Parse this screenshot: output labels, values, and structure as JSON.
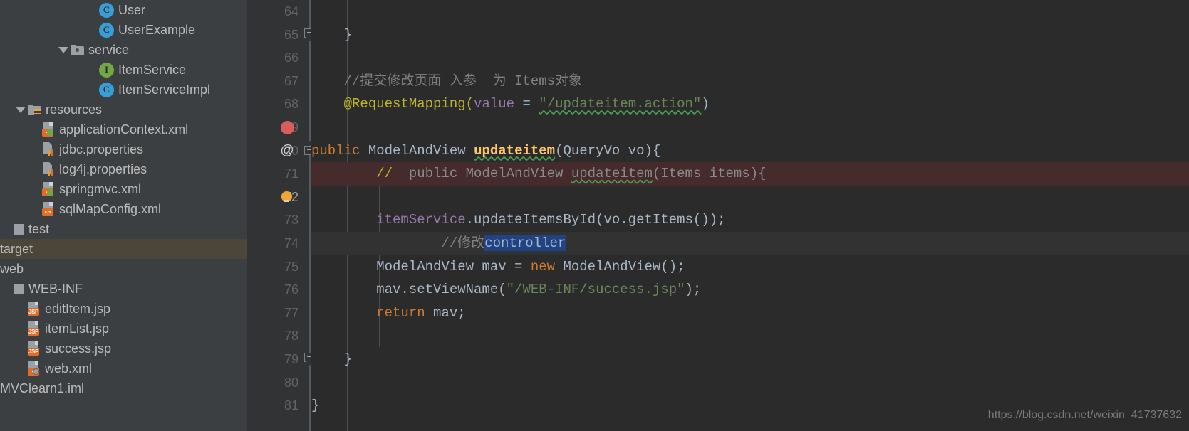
{
  "sidebar": {
    "items": [
      {
        "label": "User",
        "icon": "class-icon",
        "indent": 5,
        "arrow": false,
        "kind": "class",
        "selected": false
      },
      {
        "label": "UserExample",
        "icon": "class-icon",
        "indent": 5,
        "arrow": false,
        "kind": "class",
        "selected": false
      },
      {
        "label": "service",
        "icon": "folder-icon",
        "indent": 3,
        "arrow": true,
        "kind": "folder",
        "selected": false
      },
      {
        "label": "ItemService",
        "icon": "interface-icon",
        "indent": 5,
        "arrow": false,
        "kind": "interface",
        "selected": false
      },
      {
        "label": "ItemServiceImpl",
        "icon": "class-icon",
        "indent": 5,
        "arrow": false,
        "kind": "class",
        "selected": false
      },
      {
        "label": "resources",
        "icon": "resources-folder-icon",
        "indent": 0,
        "arrow": true,
        "kind": "resfolder",
        "selected": false
      },
      {
        "label": "applicationContext.xml",
        "icon": "spring-xml-icon",
        "indent": 1,
        "arrow": false,
        "kind": "springxml",
        "selected": false
      },
      {
        "label": "jdbc.properties",
        "icon": "properties-icon",
        "indent": 1,
        "arrow": false,
        "kind": "props",
        "selected": false
      },
      {
        "label": "log4j.properties",
        "icon": "properties-icon",
        "indent": 1,
        "arrow": false,
        "kind": "props",
        "selected": false
      },
      {
        "label": "springmvc.xml",
        "icon": "spring-xml-icon",
        "indent": 1,
        "arrow": false,
        "kind": "springxml",
        "selected": false
      },
      {
        "label": "sqlMapConfig.xml",
        "icon": "xml-icon",
        "indent": 1,
        "arrow": false,
        "kind": "xml",
        "selected": false
      },
      {
        "label": "test",
        "icon": "module-square-icon",
        "indent": -1,
        "arrow": false,
        "kind": "square",
        "selected": false
      },
      {
        "label": "target",
        "icon": "none",
        "indent": -2,
        "arrow": false,
        "kind": "none",
        "selected": true
      },
      {
        "label": "web",
        "icon": "none",
        "indent": -2,
        "arrow": false,
        "kind": "none",
        "selected": false
      },
      {
        "label": "WEB-INF",
        "icon": "module-square-icon",
        "indent": -1,
        "arrow": false,
        "kind": "square",
        "selected": false
      },
      {
        "label": "editItem.jsp",
        "icon": "jsp-icon",
        "indent": 0,
        "arrow": false,
        "kind": "jsp",
        "selected": false
      },
      {
        "label": "itemList.jsp",
        "icon": "jsp-icon",
        "indent": 0,
        "arrow": false,
        "kind": "jsp",
        "selected": false
      },
      {
        "label": "success.jsp",
        "icon": "jsp-icon",
        "indent": 0,
        "arrow": false,
        "kind": "jsp",
        "selected": false
      },
      {
        "label": "web.xml",
        "icon": "web-xml-icon",
        "indent": 0,
        "arrow": false,
        "kind": "webxml",
        "selected": false
      },
      {
        "label": "MVClearn1.iml",
        "icon": "none",
        "indent": -2,
        "arrow": false,
        "kind": "none",
        "selected": false
      }
    ]
  },
  "editor": {
    "lines": [
      {
        "num": "64",
        "gutter": "none",
        "fold": "none",
        "current": false,
        "hl": "none"
      },
      {
        "num": "65",
        "gutter": "none",
        "fold": "down",
        "current": false,
        "hl": "none"
      },
      {
        "num": "66",
        "gutter": "none",
        "fold": "none",
        "current": false,
        "hl": "none"
      },
      {
        "num": "67",
        "gutter": "none",
        "fold": "none",
        "current": false,
        "hl": "none"
      },
      {
        "num": "68",
        "gutter": "none",
        "fold": "none",
        "current": false,
        "hl": "none"
      },
      {
        "num": "69",
        "gutter": "breakpoint",
        "fold": "none",
        "current": false,
        "hl": "commented"
      },
      {
        "num": "70",
        "gutter": "annotation",
        "fold": "up",
        "current": false,
        "hl": "none"
      },
      {
        "num": "71",
        "gutter": "none",
        "fold": "none",
        "current": false,
        "hl": "none"
      },
      {
        "num": "72",
        "gutter": "bulb",
        "fold": "none",
        "current": true,
        "hl": "current"
      },
      {
        "num": "73",
        "gutter": "none",
        "fold": "none",
        "current": false,
        "hl": "none"
      },
      {
        "num": "74",
        "gutter": "none",
        "fold": "none",
        "current": false,
        "hl": "none"
      },
      {
        "num": "75",
        "gutter": "none",
        "fold": "none",
        "current": false,
        "hl": "none"
      },
      {
        "num": "76",
        "gutter": "none",
        "fold": "none",
        "current": false,
        "hl": "none"
      },
      {
        "num": "77",
        "gutter": "none",
        "fold": "none",
        "current": false,
        "hl": "none"
      },
      {
        "num": "78",
        "gutter": "none",
        "fold": "none",
        "current": false,
        "hl": "none"
      },
      {
        "num": "79",
        "gutter": "none",
        "fold": "down",
        "current": false,
        "hl": "none"
      },
      {
        "num": "80",
        "gutter": "none",
        "fold": "none",
        "current": false,
        "hl": "none"
      },
      {
        "num": "81",
        "gutter": "none",
        "fold": "none",
        "current": false,
        "hl": "none"
      }
    ],
    "code": {
      "l64": "",
      "l65": "    }",
      "l66": "",
      "l67_comment": "    //提交修改页面 入参  为 Items对象",
      "l68_at": "    @RequestMapping",
      "l68_paren_open": "(",
      "l68_value": "value",
      "l68_eq": " = ",
      "l68_str": "\"/updateitem.action\"",
      "l68_paren_close": ")",
      "l69_slashes": "//  ",
      "l69_rest": "public ModelAndView ",
      "l69_method": "updateitem",
      "l69_tail": "(Items items){",
      "l70_public": "public",
      "l70_type": " ModelAndView ",
      "l70_method": "updateitem",
      "l70_tail": "(QueryVo vo){",
      "l71": "",
      "l72_comment": "        //修改",
      "l72_selected": "controller",
      "l73_obj": "        itemService",
      "l73_call": ".updateItemsById(vo.getItems());",
      "l74": "",
      "l75_type": "        ModelAndView mav = ",
      "l75_new": "new",
      "l75_ctor": " ModelAndView();",
      "l76_call": "        mav.setViewName(",
      "l76_str": "\"/WEB-INF/success.jsp\"",
      "l76_tail": ");",
      "l77_kw": "        return",
      "l77_var": " mav;",
      "l78": "",
      "l79": "    }",
      "l80": "",
      "l81": "}"
    }
  },
  "watermark": {
    "url": "https://blog.csdn.net/weixin_41737632"
  },
  "colors": {
    "sidebar_bg": "#3c3f41",
    "editor_bg": "#2b2b2b",
    "gutter_bg": "#313335",
    "selection_blue": "#214283",
    "selected_row": "#4b4639",
    "breakpoint_red": "#db5c5c",
    "commented_line": "#452b2b",
    "keyword_orange": "#cc7832",
    "annotation_yellow": "#bbb529",
    "string_green": "#6a8759",
    "method_yellow": "#ffc66d",
    "field_purple": "#9876aa",
    "text_grey": "#a9b7c6"
  }
}
